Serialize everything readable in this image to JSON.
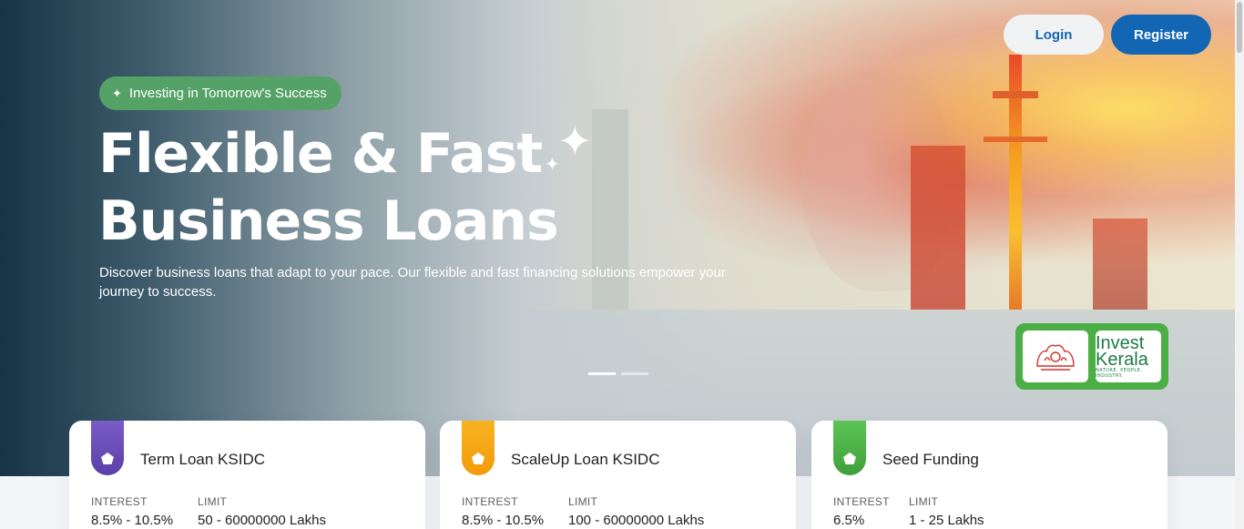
{
  "header": {
    "login_label": "Login",
    "register_label": "Register"
  },
  "hero": {
    "tagline": "Investing in Tomorrow's Success",
    "title_line1": "Flexible & Fast",
    "title_line2": "Business Loans",
    "subtitle": "Discover business loans that adapt to your pace. Our flexible and fast financing solutions empower your journey to success.",
    "slides_count": 2,
    "active_slide": 1
  },
  "partner_logos": {
    "invest_kerala_line1": "Invest",
    "invest_kerala_line2": "Kerala",
    "invest_kerala_sub": "NATURE. PEOPLE. INDUSTRY."
  },
  "loan_cards": [
    {
      "title": "Term Loan KSIDC",
      "interest_label": "INTEREST",
      "interest": "8.5% - 10.5%",
      "limit_label": "LIMIT",
      "limit": "50 - 60000000 Lakhs",
      "badge_color": "#5b3fa8"
    },
    {
      "title": "ScaleUp Loan KSIDC",
      "interest_label": "INTEREST",
      "interest": "8.5% - 10.5%",
      "limit_label": "LIMIT",
      "limit": "100 - 60000000 Lakhs",
      "badge_color": "#f3a10b"
    },
    {
      "title": "Seed Funding",
      "interest_label": "INTEREST",
      "interest": "6.5%",
      "limit_label": "LIMIT",
      "limit": "1 - 25 Lakhs",
      "badge_color": "#4caf46"
    }
  ],
  "colors": {
    "primary": "#1366b3",
    "pill": "#55a266",
    "logo_frame": "#4caf46"
  }
}
